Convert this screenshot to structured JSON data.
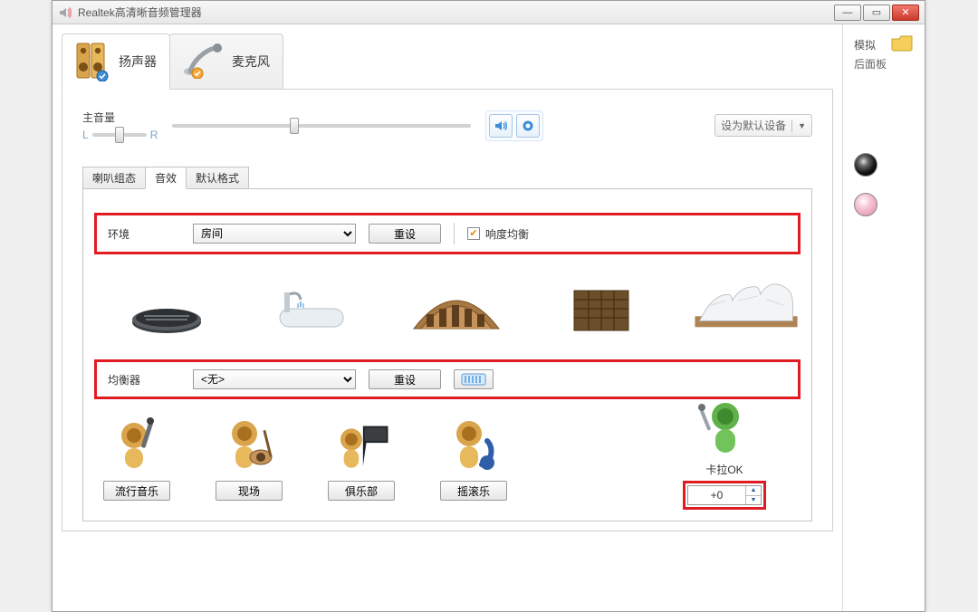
{
  "window": {
    "title": "Realtek高清晰音频管理器"
  },
  "device_tabs": {
    "speaker": "扬声器",
    "mic": "麦克风"
  },
  "volume": {
    "label": "主音量",
    "L": "L",
    "R": "R",
    "default_device": "设为默认设备"
  },
  "subtabs": {
    "config": "喇叭组态",
    "effects": "音效",
    "format": "默认格式"
  },
  "environment": {
    "label": "环境",
    "selected": "房间",
    "reset": "重设",
    "loudness": "响度均衡"
  },
  "eq": {
    "label": "均衡器",
    "selected": "<无>",
    "reset": "重设",
    "presets": {
      "pop": "流行音乐",
      "live": "现场",
      "club": "俱乐部",
      "rock": "摇滚乐"
    },
    "karaoke_label": "卡拉OK",
    "karaoke_value": "+0"
  },
  "aside": {
    "section": "模拟",
    "panel": "后面板"
  }
}
